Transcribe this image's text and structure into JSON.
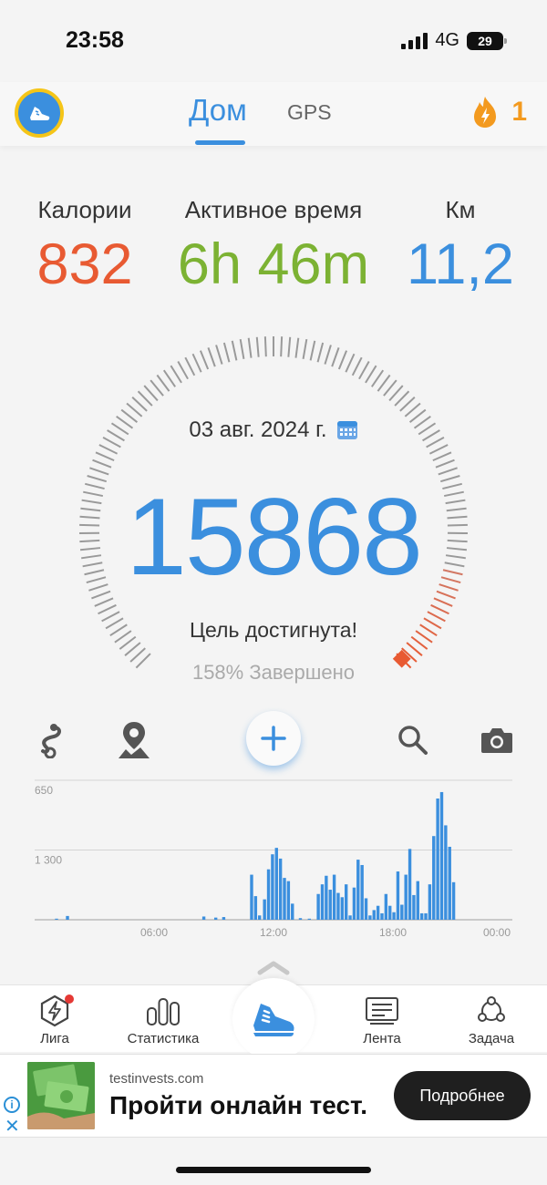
{
  "status_bar": {
    "time": "23:58",
    "network": "4G",
    "battery": "29"
  },
  "header": {
    "tab_home": "Дом",
    "tab_gps": "GPS",
    "streak_count": "1"
  },
  "stats": {
    "calories": {
      "label": "Калории",
      "value": "832",
      "color": "#e85a32"
    },
    "active_time": {
      "label": "Активное время",
      "value": "6h 46m",
      "color": "#7cb233"
    },
    "km": {
      "label": "Км",
      "value": "11,2",
      "color": "#3b8fde"
    }
  },
  "gauge": {
    "date": "03 авг. 2024 г.",
    "steps": "15868",
    "goal_text": "Цель достигнута!",
    "complete_text": "158% Завершено",
    "progress_percent": 158
  },
  "chart_data": {
    "type": "bar",
    "ytick_labels": [
      "1 300",
      "650"
    ],
    "xtick_labels": [
      "06:00",
      "12:00",
      "18:00",
      "00:00"
    ],
    "ylim": [
      0,
      1300
    ],
    "x_unit": "hours",
    "x_range": [
      0,
      24
    ],
    "xticks": [
      6,
      12,
      18,
      24
    ],
    "yticks": [
      650,
      1300
    ],
    "color": "#3b8fde",
    "bars": [
      {
        "x": 1.1,
        "y": 10
      },
      {
        "x": 1.65,
        "y": 35
      },
      {
        "x": 8.5,
        "y": 30
      },
      {
        "x": 9.1,
        "y": 20
      },
      {
        "x": 9.5,
        "y": 25
      },
      {
        "x": 10.9,
        "y": 420
      },
      {
        "x": 11.1,
        "y": 220
      },
      {
        "x": 11.3,
        "y": 40
      },
      {
        "x": 11.55,
        "y": 190
      },
      {
        "x": 11.75,
        "y": 470
      },
      {
        "x": 11.95,
        "y": 610
      },
      {
        "x": 12.15,
        "y": 670
      },
      {
        "x": 12.35,
        "y": 570
      },
      {
        "x": 12.55,
        "y": 390
      },
      {
        "x": 12.75,
        "y": 360
      },
      {
        "x": 12.95,
        "y": 150
      },
      {
        "x": 13.35,
        "y": 15
      },
      {
        "x": 13.8,
        "y": 10
      },
      {
        "x": 14.25,
        "y": 240
      },
      {
        "x": 14.45,
        "y": 330
      },
      {
        "x": 14.65,
        "y": 410
      },
      {
        "x": 14.85,
        "y": 280
      },
      {
        "x": 15.05,
        "y": 420
      },
      {
        "x": 15.25,
        "y": 250
      },
      {
        "x": 15.45,
        "y": 210
      },
      {
        "x": 15.65,
        "y": 330
      },
      {
        "x": 15.85,
        "y": 40
      },
      {
        "x": 16.05,
        "y": 300
      },
      {
        "x": 16.25,
        "y": 560
      },
      {
        "x": 16.45,
        "y": 510
      },
      {
        "x": 16.65,
        "y": 200
      },
      {
        "x": 16.85,
        "y": 40
      },
      {
        "x": 17.05,
        "y": 90
      },
      {
        "x": 17.25,
        "y": 130
      },
      {
        "x": 17.45,
        "y": 60
      },
      {
        "x": 17.65,
        "y": 240
      },
      {
        "x": 17.85,
        "y": 130
      },
      {
        "x": 18.05,
        "y": 70
      },
      {
        "x": 18.25,
        "y": 450
      },
      {
        "x": 18.45,
        "y": 140
      },
      {
        "x": 18.65,
        "y": 420
      },
      {
        "x": 18.85,
        "y": 660
      },
      {
        "x": 19.05,
        "y": 230
      },
      {
        "x": 19.25,
        "y": 360
      },
      {
        "x": 19.45,
        "y": 60
      },
      {
        "x": 19.65,
        "y": 60
      },
      {
        "x": 19.85,
        "y": 330
      },
      {
        "x": 20.05,
        "y": 780
      },
      {
        "x": 20.25,
        "y": 1130
      },
      {
        "x": 20.45,
        "y": 1190
      },
      {
        "x": 20.65,
        "y": 880
      },
      {
        "x": 20.85,
        "y": 680
      },
      {
        "x": 21.05,
        "y": 350
      }
    ]
  },
  "bottom_nav": {
    "league": "Лига",
    "stats": "Статистика",
    "feed": "Лента",
    "task": "Задача"
  },
  "ad": {
    "domain": "testinvests.com",
    "title": "Пройти онлайн тест.",
    "cta": "Подробнее"
  },
  "colors": {
    "accent": "#3b8fde",
    "gauge_tick": "#9a9a9a",
    "gauge_end": "#e85a32",
    "streak": "#f39a1f"
  }
}
